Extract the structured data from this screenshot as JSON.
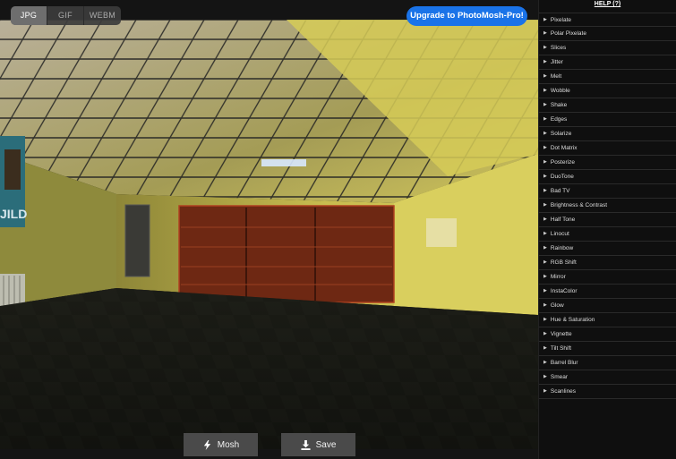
{
  "tabs": [
    {
      "label": "JPG",
      "active": true
    },
    {
      "label": "GIF",
      "active": false
    },
    {
      "label": "WEBM",
      "active": false
    }
  ],
  "upgrade_label": "Upgrade to PhotoMosh-Pro!",
  "actions": {
    "mosh_label": "Mosh",
    "save_label": "Save"
  },
  "sidebar": {
    "help_label": "HELP (?)",
    "effects": [
      "Pixelate",
      "Polar Pixelate",
      "Slices",
      "Jitter",
      "Melt",
      "Wobble",
      "Shake",
      "Edges",
      "Solarize",
      "Dot Matrix",
      "Posterize",
      "DuoTone",
      "Bad TV",
      "Brightness & Contrast",
      "Half Tone",
      "Linocut",
      "Rainbow",
      "RGB Shift",
      "Mirror",
      "InstaColor",
      "Glow",
      "Hue & Saturation",
      "Vignette",
      "Tilt Shift",
      "Barrel Blur",
      "Smear",
      "Scanlines"
    ]
  },
  "poster_text": "JILD",
  "colors": {
    "accent": "#1a73e8",
    "wall": "#c9bd4a",
    "ceiling": "#bfb56a",
    "shelf": "#7a2e14"
  }
}
